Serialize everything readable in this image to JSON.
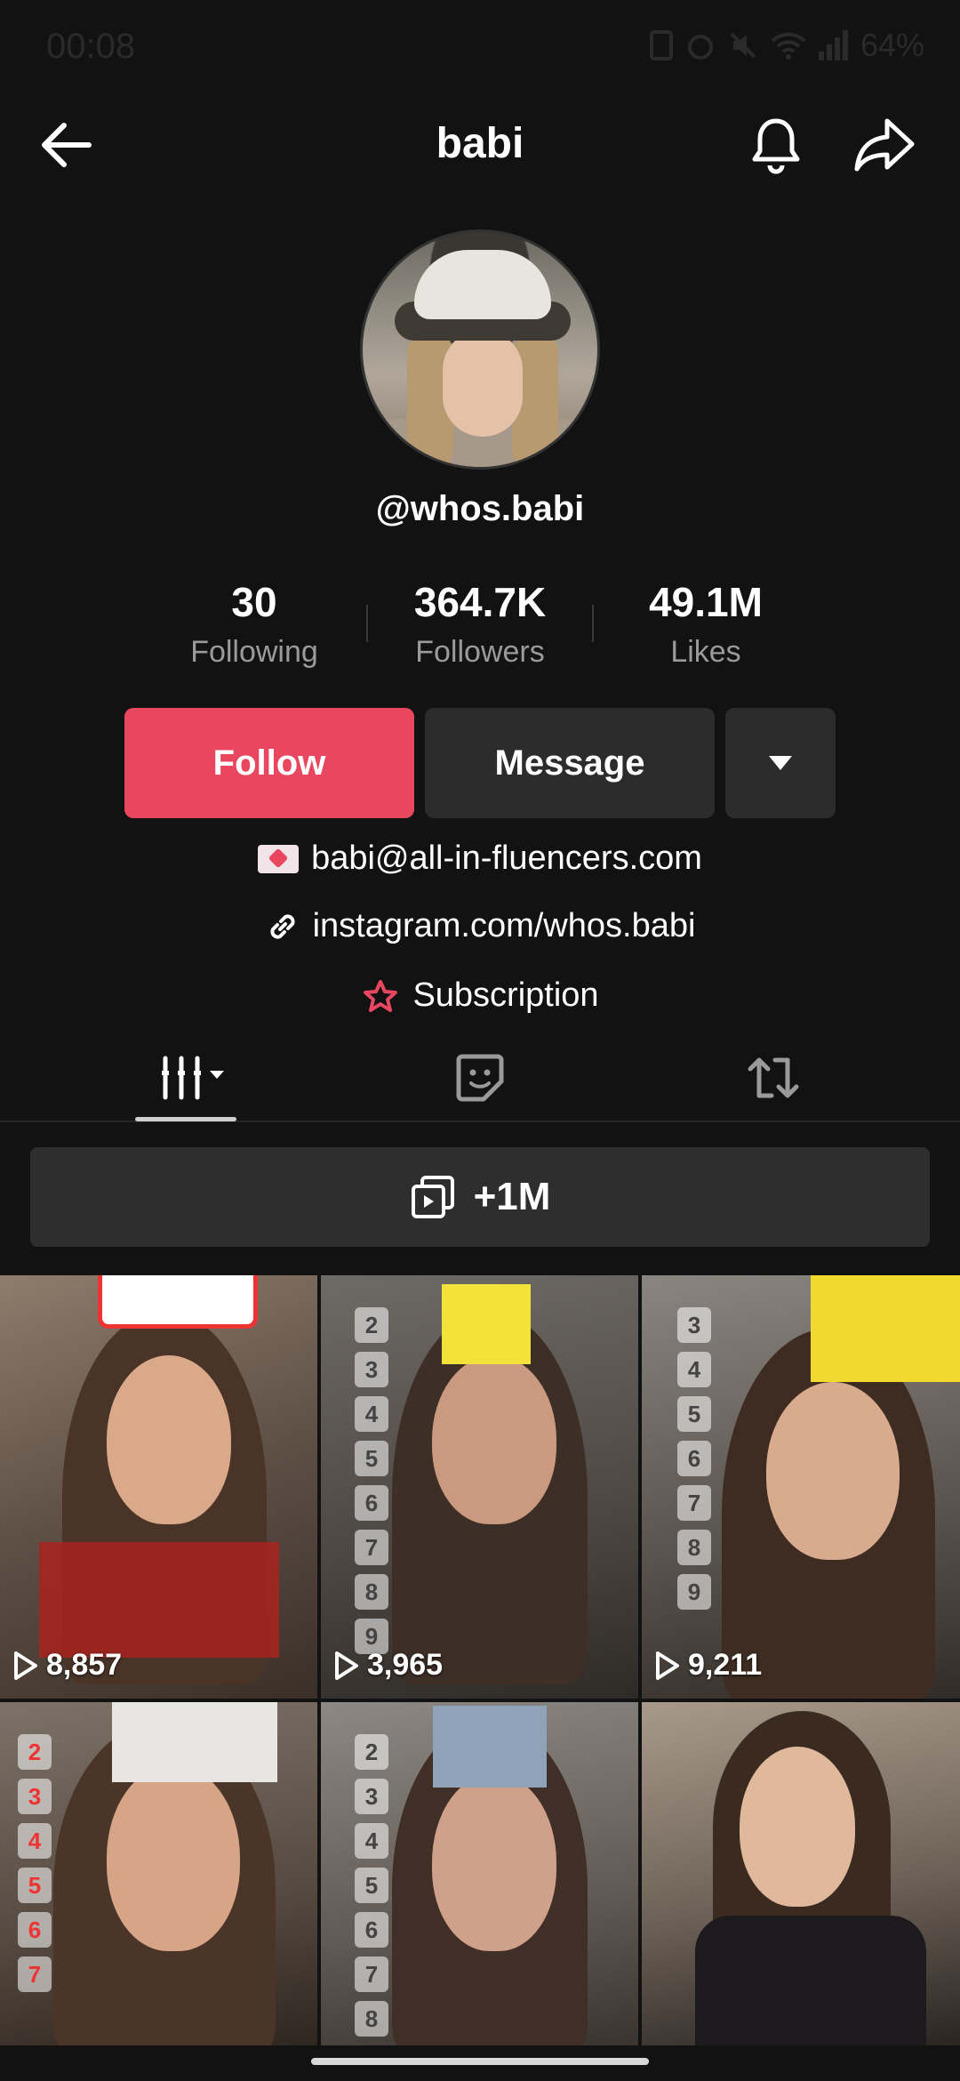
{
  "status_bar": {
    "time": "00:08",
    "battery": "64%"
  },
  "header": {
    "title": "babi"
  },
  "profile": {
    "handle": "@whos.babi",
    "stats": [
      {
        "value": "30",
        "label": "Following"
      },
      {
        "value": "364.7K",
        "label": "Followers"
      },
      {
        "value": "49.1M",
        "label": "Likes"
      }
    ],
    "follow_label": "Follow",
    "message_label": "Message",
    "email": "babi@all-in-fluencers.com",
    "link": "instagram.com/whos.babi",
    "subscription": "Subscription"
  },
  "tabs": [
    {
      "icon": "videos-grid-icon",
      "selected": true
    },
    {
      "icon": "favorites-sticker-icon",
      "selected": false
    },
    {
      "icon": "reposts-icon",
      "selected": false
    }
  ],
  "collection": {
    "label": "+1M"
  },
  "videos": [
    {
      "views": "8,857"
    },
    {
      "views": "3,965"
    },
    {
      "views": "9,211"
    },
    {
      "views": ""
    },
    {
      "views": ""
    },
    {
      "views": ""
    }
  ],
  "colors": {
    "accent": "#e8475f",
    "background": "#121212",
    "button": "#2c2c2c"
  }
}
